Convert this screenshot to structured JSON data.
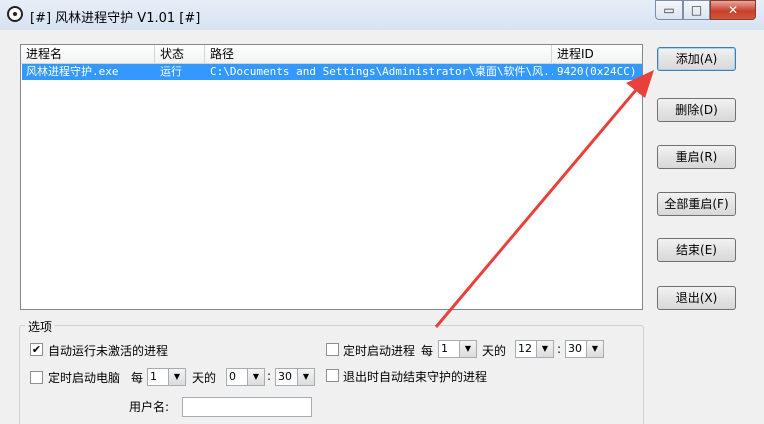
{
  "window": {
    "title": "[#] 风林进程守护 V1.01 [#]",
    "min_glyph": "▭",
    "max_glyph": "□",
    "close_glyph": "✕"
  },
  "list": {
    "columns": [
      "进程名",
      "状态",
      "路径",
      "进程ID"
    ],
    "rows": [
      {
        "name": "风林进程守护.exe",
        "status": "运行",
        "path": "C:\\Documents and Settings\\Administrator\\桌面\\软件\\风...",
        "pid": "9420(0x24CC)"
      }
    ]
  },
  "buttons": {
    "add": "添加(A)",
    "delete": "删除(D)",
    "restart": "重启(R)",
    "restart_all": "全部重启(F)",
    "end": "结束(E)",
    "exit": "退出(X)"
  },
  "options": {
    "group_title": "选项",
    "auto_run": {
      "label": "自动运行未激活的进程",
      "checked": "✔"
    },
    "timed_start_proc": {
      "label": "定时启动进程",
      "every": "每",
      "days_label": "天的",
      "days": "1",
      "hour": "12",
      "minute": "30"
    },
    "timed_start_pc": {
      "label": "定时启动电脑",
      "every": "每",
      "days_label": "天的",
      "days": "1",
      "hour": "0",
      "minute": "30"
    },
    "exit_end": {
      "label": "退出时自动结束守护的进程"
    },
    "colon": ":",
    "username_label": "用户名:",
    "username_value": ""
  },
  "colors": {
    "selection": "#3399ff",
    "annotation_arrow": "#e8403a"
  }
}
